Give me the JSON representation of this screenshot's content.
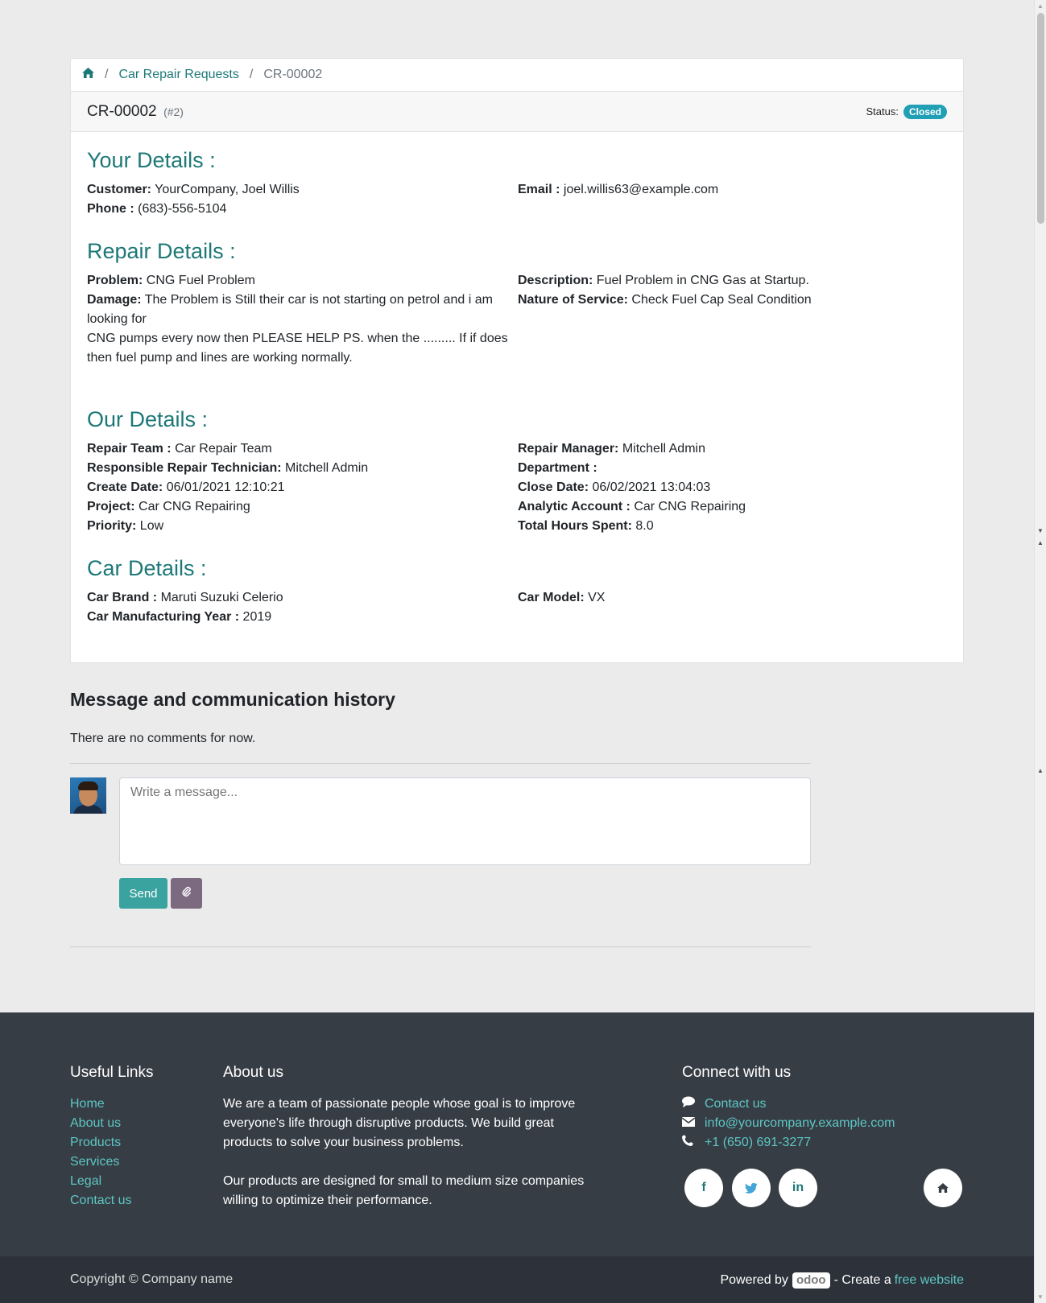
{
  "breadcrumb": {
    "home_icon": "home-icon",
    "parent": "Car Repair Requests",
    "current": "CR-00002"
  },
  "header": {
    "title": "CR-00002",
    "record_id": "(#2)",
    "status_label": "Status:",
    "status_value": "Closed"
  },
  "your_details": {
    "title": "Your Details :",
    "customer_label": "Customer:",
    "customer_value": "YourCompany, Joel Willis",
    "phone_label": "Phone :",
    "phone_value": "(683)-556-5104",
    "email_label": "Email :",
    "email_value": "joel.willis63@example.com"
  },
  "repair_details": {
    "title": "Repair Details :",
    "problem_label": "Problem:",
    "problem_value": "CNG Fuel Problem",
    "damage_label": "Damage:",
    "damage_value_1": "The Problem is Still their car is not starting on petrol and i am looking for",
    "damage_value_2": "CNG pumps every now then PLEASE HELP PS. when the ......... If if does then fuel pump and lines are working normally.",
    "description_label": "Description:",
    "description_value": "Fuel Problem in CNG Gas at Startup.",
    "service_label": "Nature of Service:",
    "service_value": "Check Fuel Cap Seal Condition"
  },
  "our_details": {
    "title": "Our Details :",
    "team_label": "Repair Team :",
    "team_value": "Car Repair Team",
    "technician_label": "Responsible Repair Technician:",
    "technician_value": "Mitchell Admin",
    "create_label": "Create Date:",
    "create_value": "06/01/2021 12:10:21",
    "project_label": "Project:",
    "project_value": "Car CNG Repairing",
    "priority_label": "Priority:",
    "priority_value": "Low",
    "manager_label": "Repair Manager:",
    "manager_value": "Mitchell Admin",
    "department_label": "Department :",
    "department_value": "",
    "close_label": "Close Date:",
    "close_value": "06/02/2021 13:04:03",
    "analytic_label": "Analytic Account :",
    "analytic_value": "Car CNG Repairing",
    "hours_label": "Total Hours Spent:",
    "hours_value": "8.0"
  },
  "car_details": {
    "title": "Car Details :",
    "brand_label": "Car Brand :",
    "brand_value": "Maruti Suzuki Celerio",
    "year_label": "Car Manufacturing Year :",
    "year_value": "2019",
    "model_label": "Car Model:",
    "model_value": "VX"
  },
  "messages": {
    "title": "Message and communication history",
    "empty_text": "There are no comments for now.",
    "placeholder": "Write a message...",
    "send_label": "Send",
    "attach_icon": "paperclip-icon"
  },
  "footer": {
    "useful_links_title": "Useful Links",
    "links": [
      "Home",
      "About us",
      "Products",
      "Services",
      "Legal",
      "Contact us"
    ],
    "about_title": "About us",
    "about_p1": "We are a team of passionate people whose goal is to improve everyone's life through disruptive products. We build great products to solve your business problems.",
    "about_p2": "Our products are designed for small to medium size companies willing to optimize their performance.",
    "connect_title": "Connect with us",
    "contact_us": "Contact us",
    "email": "info@yourcompany.example.com",
    "phone": "+1 (650) 691-3277",
    "social": [
      "facebook-icon",
      "twitter-icon",
      "linkedin-icon",
      "home-icon"
    ],
    "copyright": "Copyright © Company name",
    "powered_by": "Powered by",
    "odoo": "odoo",
    "create_a": "- Create a",
    "free_website": "free website"
  },
  "colors": {
    "accent": "#1e7878",
    "status_badge": "#21a0b5",
    "send_button": "#3aa39f",
    "attach_button": "#7c6a80",
    "footer_bg": "#373d45",
    "footer_link": "#5cc7c4"
  }
}
